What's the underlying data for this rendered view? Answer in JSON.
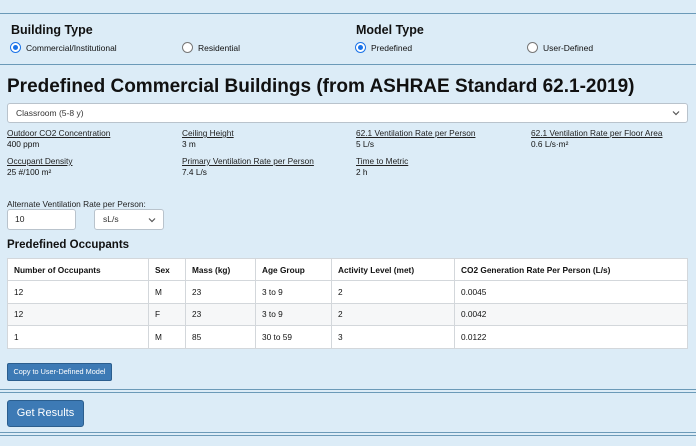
{
  "building_type": {
    "heading": "Building Type",
    "options": [
      {
        "label": "Commercial/Institutional",
        "selected": true
      },
      {
        "label": "Residential",
        "selected": false
      }
    ]
  },
  "model_type": {
    "heading": "Model Type",
    "options": [
      {
        "label": "Predefined",
        "selected": true
      },
      {
        "label": "User-Defined",
        "selected": false
      }
    ]
  },
  "main": {
    "title": "Predefined Commercial Buildings (from ASHRAE Standard 62.1-2019)",
    "building_select": {
      "value": "Classroom (5-8 y)"
    },
    "fields": [
      {
        "label": "Outdoor CO2 Concentration",
        "value": "400 ppm"
      },
      {
        "label": "Ceiling Height",
        "value": "3 m"
      },
      {
        "label": "62.1 Ventilation Rate per Person",
        "value": "5 L/s"
      },
      {
        "label": "62.1 Ventilation Rate per Floor Area",
        "value": "0.6 L/s·m²"
      },
      {
        "label": "Occupant Density",
        "value": "25 #/100 m²"
      },
      {
        "label": "Primary Ventilation Rate per Person",
        "value": "7.4 L/s"
      },
      {
        "label": "Time to Metric",
        "value": "2 h"
      }
    ],
    "alternate": {
      "label": "Alternate Ventilation Rate per Person:",
      "value": "10",
      "unit": "sL/s"
    },
    "occupants": {
      "heading": "Predefined Occupants",
      "columns": [
        "Number of Occupants",
        "Sex",
        "Mass (kg)",
        "Age Group",
        "Activity Level (met)",
        "CO2 Generation Rate Per Person (L/s)"
      ],
      "rows": [
        [
          "12",
          "M",
          "23",
          "3 to 9",
          "2",
          "0.0045"
        ],
        [
          "12",
          "F",
          "23",
          "3 to 9",
          "2",
          "0.0042"
        ],
        [
          "1",
          "M",
          "85",
          "30 to 59",
          "3",
          "0.0122"
        ]
      ]
    },
    "copy_button": "Copy to User-Defined Model",
    "results_button": "Get Results"
  }
}
